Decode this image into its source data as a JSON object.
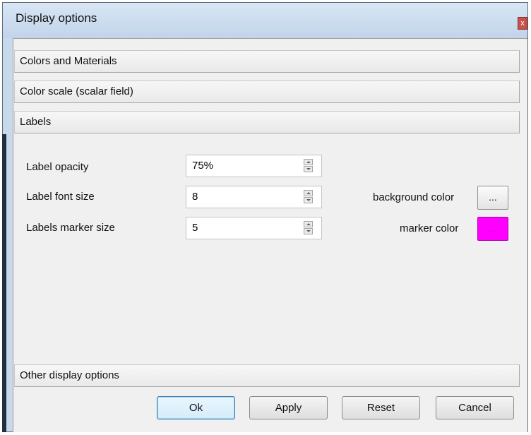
{
  "window": {
    "title": "Display options",
    "close_glyph": "x"
  },
  "sections": {
    "colors_materials": "Colors and Materials",
    "color_scale": "Color scale (scalar field)",
    "labels": "Labels",
    "other": "Other display options"
  },
  "labels_panel": {
    "opacity": {
      "label": "Label opacity",
      "value": "75%"
    },
    "font_size": {
      "label": "Label font size",
      "value": "8"
    },
    "marker_size": {
      "label": "Labels marker size",
      "value": "5"
    },
    "background_color": {
      "label": "background color",
      "button": "...",
      "color": "#ffffff"
    },
    "marker_color": {
      "label": "marker color",
      "button": "...",
      "color": "#ff00ff"
    }
  },
  "buttons": {
    "ok": "Ok",
    "apply": "Apply",
    "reset": "Reset",
    "cancel": "Cancel"
  },
  "icons": [
    "close-icon",
    "spin-up-icon",
    "spin-down-icon"
  ]
}
